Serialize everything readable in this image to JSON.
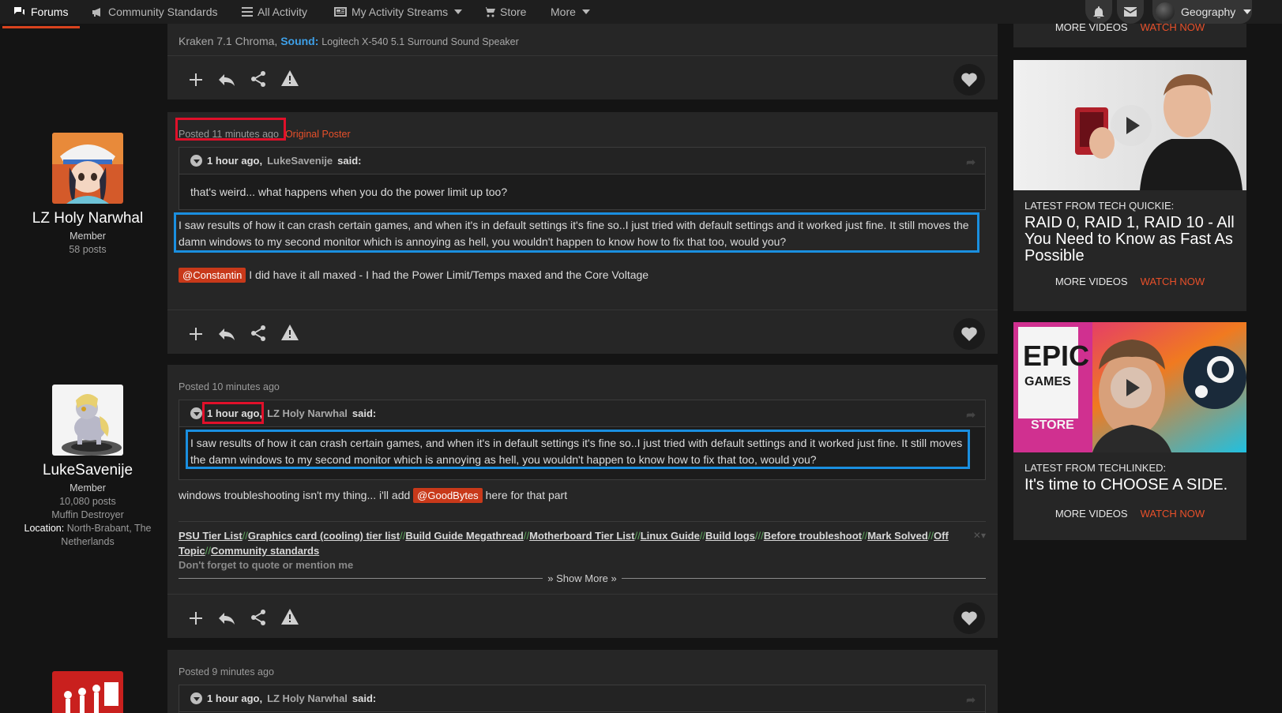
{
  "nav": {
    "forums": "Forums",
    "community_standards": "Community Standards",
    "all_activity": "All Activity",
    "activity_streams": "My Activity Streams",
    "store": "Store",
    "more": "More",
    "user": "Geography"
  },
  "post0": {
    "sig_partial_prefix": "Kraken 7.1 Chroma,",
    "sig_sound_label": "Sound:",
    "sig_sound_value": "Logitech X-540 5.1 Surround Sound Speaker"
  },
  "post1": {
    "author": {
      "name": "LZ Holy Narwhal",
      "role": "Member",
      "posts": "58 posts"
    },
    "posted": "Posted 11 minutes ago",
    "badge": "Original Poster",
    "quote_time": "1 hour ago,",
    "quote_author": "LukeSavenije",
    "quote_said": "said:",
    "quote_text": "that's weird... what happens when you do the power limit up too?",
    "text1": "I saw results of how it can crash certain games, and when it's in default settings it's fine so..I just tried with default settings and it worked just fine. It still moves the damn windows to my second monitor which is annoying as hell, you wouldn't happen to know how to fix that too, would you?",
    "mention": "@Constantin",
    "text2": "I did have it all maxed - I had the Power Limit/Temps maxed and the Core Voltage"
  },
  "post2": {
    "author": {
      "name": "LukeSavenije",
      "role": "Member",
      "posts": "10,080 posts",
      "title": "Muffin Destroyer",
      "location_label": "Location:",
      "location_value": "North-Brabant, The Netherlands"
    },
    "posted": "Posted 10 minutes ago",
    "quote_time": "1 hour ago,",
    "quote_author": "LZ Holy Narwhal",
    "quote_said": "said:",
    "quote_text": "I saw results of how it can crash certain games, and when it's in default settings it's fine so..I just tried with default settings and it worked just fine. It still moves the damn windows to my second monitor which is annoying as hell, you wouldn't happen to know how to fix that too, would you?",
    "text_before": "windows troubleshooting isn't my thing... i'll add",
    "mention": "@GoodBytes",
    "text_after": "here for that part",
    "signature": {
      "links": [
        "PSU Tier List",
        "Graphics card (cooling) tier list",
        "Build Guide Megathread",
        "Motherboard Tier List",
        "Linux Guide",
        "Build logs",
        "Before troubleshoot",
        "Mark Solved",
        "Off Topic",
        "Community standards"
      ],
      "separators": [
        "//",
        "//",
        "//",
        "//",
        "//",
        "///",
        "//",
        "//",
        "//"
      ],
      "note": "Don't forget to quote or mention me",
      "show_more": "Show More"
    }
  },
  "post3": {
    "posted": "Posted 9 minutes ago",
    "quote_time": "1 hour ago,",
    "quote_author": "LZ Holy Narwhal",
    "quote_said": "said:"
  },
  "widgets": {
    "top_partial": {
      "more": "MORE VIDEOS",
      "watch": "WATCH NOW"
    },
    "w1": {
      "kicker": "LATEST FROM TECH QUICKIE:",
      "title": "RAID 0, RAID 1, RAID 10 - All You Need to Know as Fast As Possible",
      "more": "MORE VIDEOS",
      "watch": "WATCH NOW"
    },
    "w2": {
      "kicker": "LATEST FROM TECHLINKED:",
      "title": "It's time to CHOOSE A SIDE.",
      "thumb_logo_1": "EPIC",
      "thumb_logo_2": "GAMES",
      "thumb_logo_3": "STORE",
      "more": "MORE VIDEOS",
      "watch": "WATCH NOW"
    }
  },
  "colors": {
    "accent": "#d9431e",
    "highlight_red": "#e0102a",
    "highlight_blue": "#1a8fe0",
    "mention": "#c8391a",
    "link_sep": "#5fa85f"
  }
}
